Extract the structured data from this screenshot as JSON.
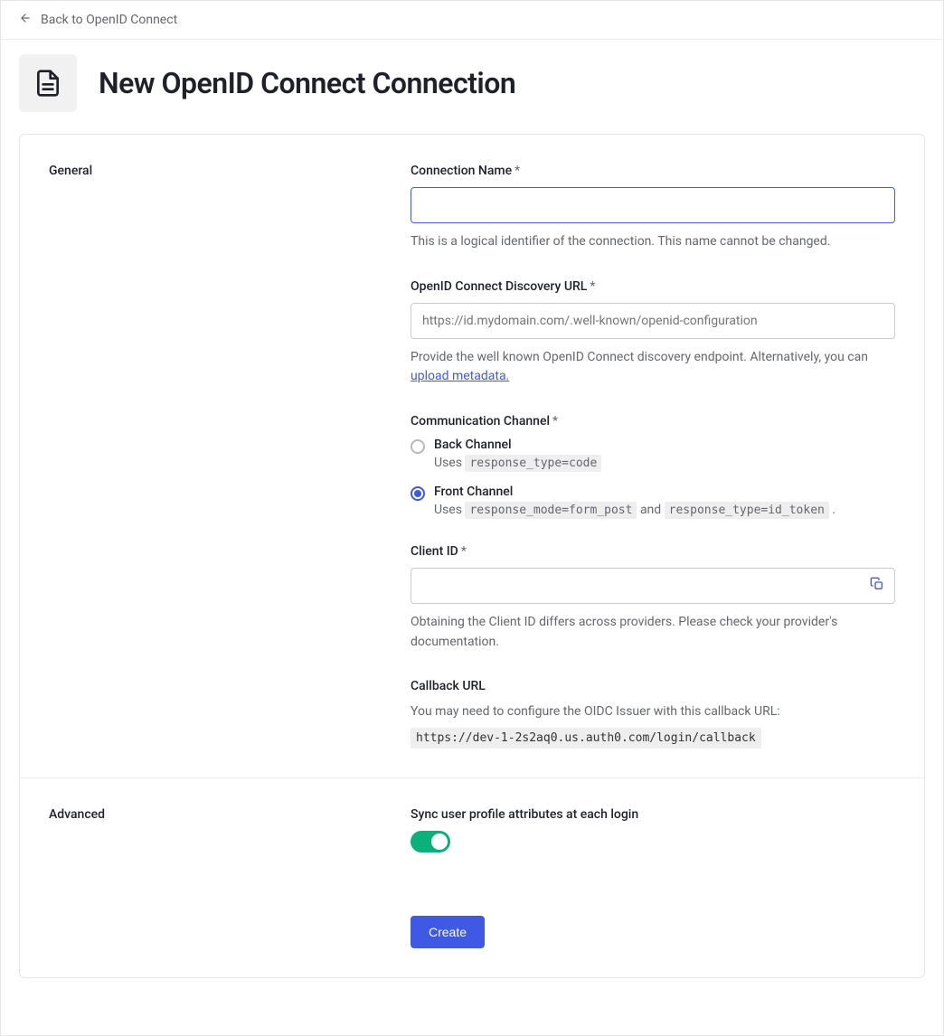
{
  "back": {
    "label": "Back to OpenID Connect"
  },
  "page": {
    "title": "New OpenID Connect Connection"
  },
  "sections": {
    "general": {
      "title": "General"
    },
    "advanced": {
      "title": "Advanced"
    }
  },
  "fields": {
    "connectionName": {
      "label": "Connection Name",
      "value": "",
      "help": "This is a logical identifier of the connection. This name cannot be changed."
    },
    "discoveryUrl": {
      "label": "OpenID Connect Discovery URL",
      "placeholder": "https://id.mydomain.com/.well-known/openid-configuration",
      "help_prefix": "Provide the well known OpenID Connect discovery endpoint. Alternatively, you can ",
      "help_link": "upload metadata."
    },
    "commChannel": {
      "label": "Communication Channel",
      "options": {
        "back": {
          "label": "Back Channel",
          "desc_prefix": "Uses ",
          "desc_code": "response_type=code"
        },
        "front": {
          "label": "Front Channel",
          "desc_prefix": "Uses ",
          "desc_code1": "response_mode=form_post",
          "desc_mid": " and ",
          "desc_code2": "response_type=id_token",
          "desc_suffix": " ."
        }
      },
      "selected": "front"
    },
    "clientId": {
      "label": "Client ID",
      "value": "",
      "help": "Obtaining the Client ID differs across providers. Please check your provider's documentation."
    },
    "callback": {
      "label": "Callback URL",
      "help": "You may need to configure the OIDC Issuer with this callback URL:",
      "url": "https://dev-1-2s2aq0.us.auth0.com/login/callback"
    },
    "syncProfile": {
      "label": "Sync user profile attributes at each login",
      "enabled": true
    }
  },
  "actions": {
    "create": "Create"
  },
  "reqMark": "*"
}
